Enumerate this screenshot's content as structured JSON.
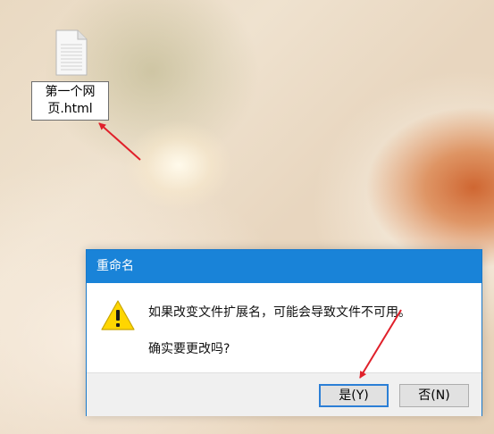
{
  "desktop": {
    "file": {
      "icon": "document-icon",
      "name_line1": "第一个网",
      "name_line2": "页.html"
    }
  },
  "dialog": {
    "title": "重命名",
    "icon": "warning-icon",
    "message": "如果改变文件扩展名，可能会导致文件不可用。",
    "question": "确实要更改吗?",
    "buttons": {
      "yes_label": "是(Y)",
      "no_label": "否(N)"
    }
  },
  "annotations": {
    "arrow_color": "#e0202a"
  }
}
